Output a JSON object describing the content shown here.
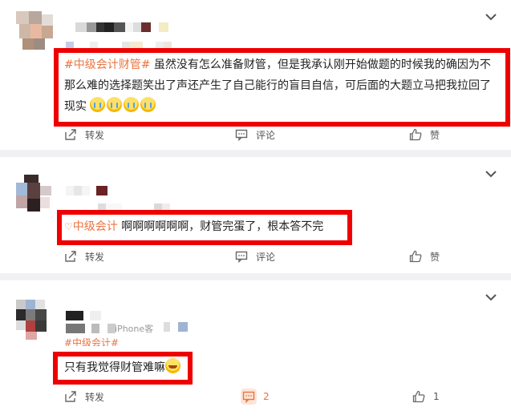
{
  "posts": [
    {
      "topic": "#中级会计财管#",
      "text": " 虽然没有怎么准备财管，但是我承认刚开始做题的时候我的确因为不那么难的选择题笑出了声还产生了自己能行的盲目自信，可后面的大题立马把我拉回了现实",
      "emoji_names": [
        "crying-face",
        "crying-face",
        "crying-face",
        "crying-face"
      ],
      "forward_label": "转发",
      "comment_label": "评论",
      "like_label": "赞"
    },
    {
      "topic": "中级会计",
      "text": " 啊啊啊啊啊啊，财管完蛋了，根本答不完",
      "forward_label": "转发",
      "comment_label": "评论",
      "like_label": "赞"
    },
    {
      "source": "iPhone客",
      "topic": "#中级会计#",
      "text": "只有我觉得财管难嘛",
      "emoji_names": [
        "laughing-face"
      ],
      "forward_label": "转发",
      "comment_count": "2",
      "like_count": "1"
    }
  ],
  "colors": {
    "highlight": "#ef0000",
    "topic": "#eb7340",
    "background": "#f1f1f3"
  }
}
